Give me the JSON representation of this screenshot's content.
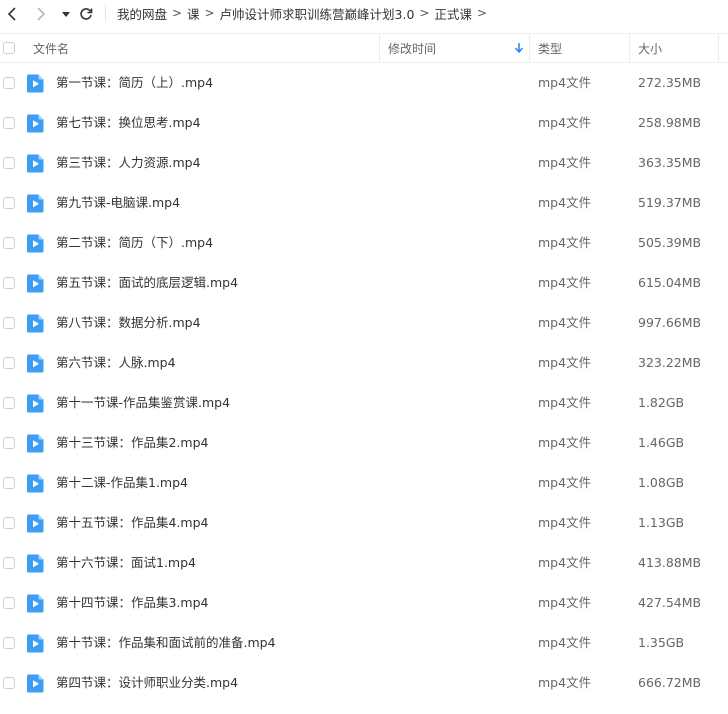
{
  "breadcrumb": [
    {
      "label": "我的网盘"
    },
    {
      "label": "课"
    },
    {
      "label": "卢帅设计师求职训练营巅峰计划3.0"
    },
    {
      "label": "正式课"
    }
  ],
  "breadcrumb_separator": ">",
  "columns": {
    "name": "文件名",
    "modified": "修改时间",
    "type": "类型",
    "size": "大小"
  },
  "sort": {
    "column": "modified",
    "icon": "sort-down-arrow-icon"
  },
  "colors": {
    "accent": "#2d8cf0",
    "file_icon": "#3d9df5",
    "text": "#333333",
    "muted": "#666666",
    "divider": "#ececec"
  },
  "files": [
    {
      "name": "第一节课：简历（上）.mp4",
      "modified": "",
      "type": "mp4文件",
      "size": "272.35MB"
    },
    {
      "name": "第七节课：换位思考.mp4",
      "modified": "",
      "type": "mp4文件",
      "size": "258.98MB"
    },
    {
      "name": "第三节课：人力资源.mp4",
      "modified": "",
      "type": "mp4文件",
      "size": "363.35MB"
    },
    {
      "name": "第九节课-电脑课.mp4",
      "modified": "",
      "type": "mp4文件",
      "size": "519.37MB"
    },
    {
      "name": "第二节课：简历（下）.mp4",
      "modified": "",
      "type": "mp4文件",
      "size": "505.39MB"
    },
    {
      "name": "第五节课：面试的底层逻辑.mp4",
      "modified": "",
      "type": "mp4文件",
      "size": "615.04MB"
    },
    {
      "name": "第八节课：数据分析.mp4",
      "modified": "",
      "type": "mp4文件",
      "size": "997.66MB"
    },
    {
      "name": "第六节课：人脉.mp4",
      "modified": "",
      "type": "mp4文件",
      "size": "323.22MB"
    },
    {
      "name": "第十一节课-作品集鉴赏课.mp4",
      "modified": "",
      "type": "mp4文件",
      "size": "1.82GB"
    },
    {
      "name": "第十三节课：作品集2.mp4",
      "modified": "",
      "type": "mp4文件",
      "size": "1.46GB"
    },
    {
      "name": "第十二课-作品集1.mp4",
      "modified": "",
      "type": "mp4文件",
      "size": "1.08GB"
    },
    {
      "name": "第十五节课：作品集4.mp4",
      "modified": "",
      "type": "mp4文件",
      "size": "1.13GB"
    },
    {
      "name": "第十六节课：面试1.mp4",
      "modified": "",
      "type": "mp4文件",
      "size": "413.88MB"
    },
    {
      "name": "第十四节课：作品集3.mp4",
      "modified": "",
      "type": "mp4文件",
      "size": "427.54MB"
    },
    {
      "name": "第十节课：作品集和面试前的准备.mp4",
      "modified": "",
      "type": "mp4文件",
      "size": "1.35GB"
    },
    {
      "name": "第四节课：设计师职业分类.mp4",
      "modified": "",
      "type": "mp4文件",
      "size": "666.72MB"
    }
  ]
}
